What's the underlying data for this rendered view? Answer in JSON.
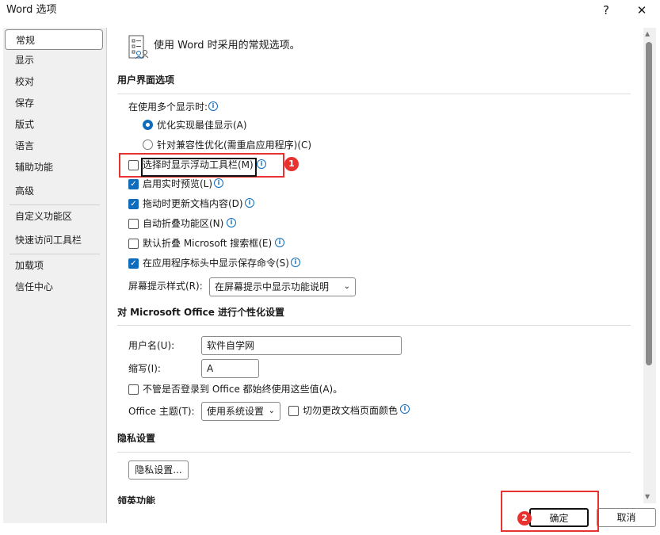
{
  "window": {
    "title": "Word 选项",
    "help": "?",
    "close": "✕"
  },
  "sidebar": {
    "items": [
      {
        "label": "常规",
        "selected": true
      },
      {
        "label": "显示"
      },
      {
        "label": "校对"
      },
      {
        "label": "保存"
      },
      {
        "label": "版式"
      },
      {
        "label": "语言"
      },
      {
        "label": "辅助功能"
      },
      {
        "label": "高级"
      },
      {
        "label": "自定义功能区"
      },
      {
        "label": "快速访问工具栏"
      },
      {
        "label": "加载项"
      },
      {
        "label": "信任中心"
      }
    ]
  },
  "main": {
    "intro": "使用 Word 时采用的常规选项。",
    "ui_section": {
      "title": "用户界面选项",
      "multi_display_label": "在使用多个显示时:",
      "radios": [
        {
          "label": "优化实现最佳显示(A)",
          "checked": true
        },
        {
          "label": "针对兼容性优化(需重启应用程序)(C)",
          "checked": false
        }
      ],
      "checkboxes": [
        {
          "label": "选择时显示浮动工具栏(M)",
          "checked": false
        },
        {
          "label": "启用实时预览(L)",
          "checked": true
        },
        {
          "label": "拖动时更新文档内容(D)",
          "checked": true
        },
        {
          "label": "自动折叠功能区(N)",
          "checked": false
        },
        {
          "label": "默认折叠 Microsoft 搜索框(E)",
          "checked": false
        },
        {
          "label": "在应用程序标头中显示保存命令(S)",
          "checked": true
        }
      ],
      "screentip_label": "屏幕提示样式(R):",
      "screentip_value": "在屏幕提示中显示功能说明"
    },
    "personal_section": {
      "title": "对 Microsoft Office 进行个性化设置",
      "username_label": "用户名(U):",
      "username_value": "软件自学网",
      "initials_label": "缩写(I):",
      "initials_value": "A",
      "always_use_label": "不管是否登录到 Office 都始终使用这些值(A)。",
      "always_use_checked": false,
      "theme_label": "Office 主题(T):",
      "theme_value": "使用系统设置",
      "no_change_color_label": "切勿更改文档页面颜色",
      "no_change_color_checked": false
    },
    "privacy_section": {
      "title": "隐私设置",
      "button": "隐私设置..."
    },
    "linkedin_section": {
      "title": "领英功能"
    }
  },
  "footer": {
    "ok": "确定",
    "cancel": "取消"
  },
  "annotations": {
    "badge1": "1",
    "badge2": "2",
    "color": "#e8322f"
  }
}
